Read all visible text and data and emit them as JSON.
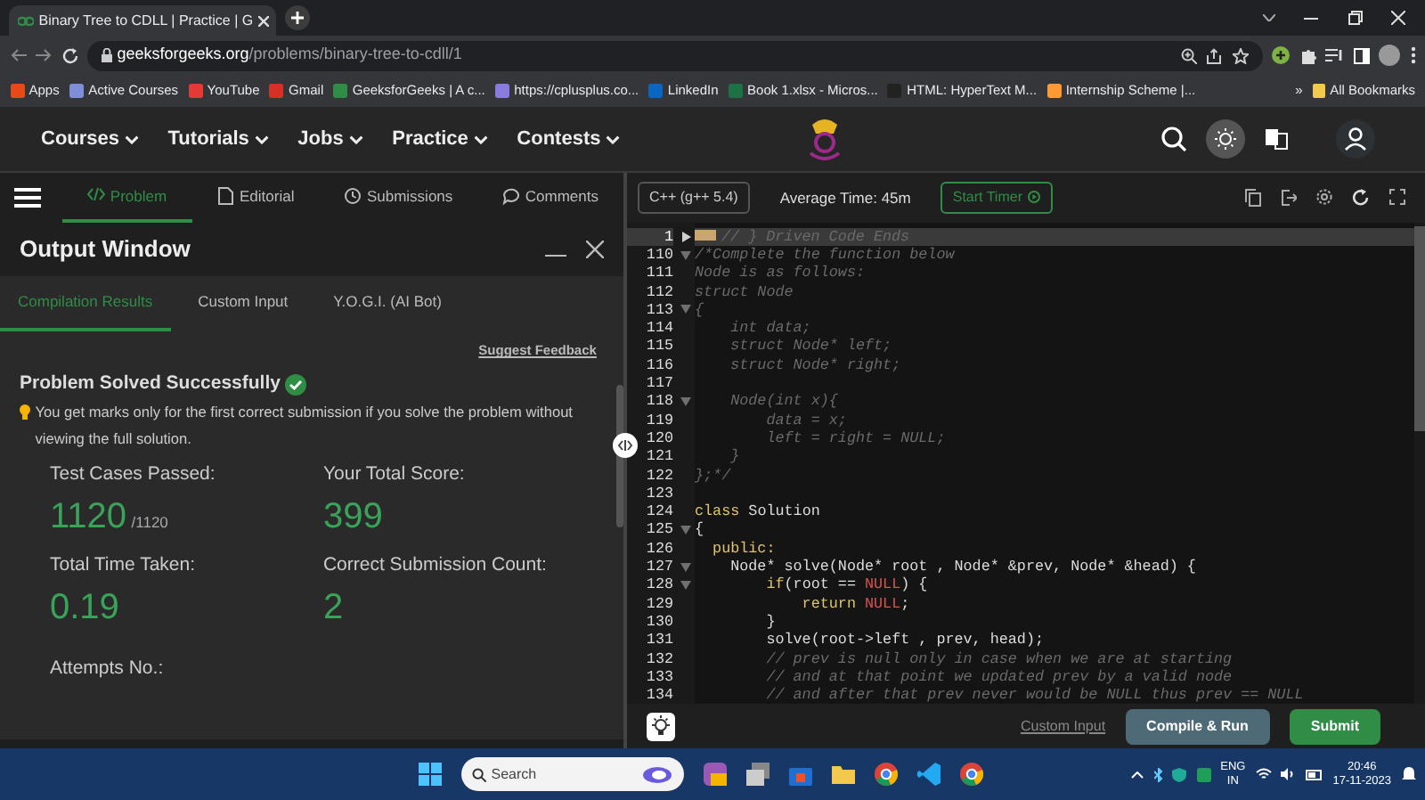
{
  "browser": {
    "tab": {
      "title": "Binary Tree to CDLL | Practice | G"
    },
    "address": {
      "domain": "geeksforgeeks.org",
      "path": "/problems/binary-tree-to-cdll/1"
    },
    "bookmarks": [
      {
        "label": "Apps"
      },
      {
        "label": "Active Courses"
      },
      {
        "label": "YouTube"
      },
      {
        "label": "Gmail"
      },
      {
        "label": "GeeksforGeeks | A c..."
      },
      {
        "label": "https://cplusplus.co..."
      },
      {
        "label": "LinkedIn"
      },
      {
        "label": "Book 1.xlsx - Micros..."
      },
      {
        "label": "HTML: HyperText M..."
      },
      {
        "label": "Internship Scheme |..."
      }
    ],
    "more": "»",
    "all_bookmarks": "All Bookmarks"
  },
  "site_nav": [
    {
      "label": "Courses"
    },
    {
      "label": "Tutorials"
    },
    {
      "label": "Jobs"
    },
    {
      "label": "Practice"
    },
    {
      "label": "Contests"
    }
  ],
  "problem_tabs": [
    {
      "label": "Problem",
      "selected": true
    },
    {
      "label": "Editorial",
      "selected": false
    },
    {
      "label": "Submissions",
      "selected": false
    },
    {
      "label": "Comments",
      "selected": false
    }
  ],
  "output_window": {
    "title": "Output Window",
    "tabs": [
      {
        "label": "Compilation Results",
        "selected": true
      },
      {
        "label": "Custom Input",
        "selected": false
      },
      {
        "label": "Y.O.G.I. (AI Bot)",
        "selected": false
      }
    ],
    "suggest_feedback": "Suggest Feedback",
    "status": "Problem Solved Successfully",
    "note": "You get marks only for the first correct submission if you solve the problem without viewing the full solution.",
    "stats": [
      {
        "label": "Test Cases Passed:",
        "value": "1120",
        "suffix": "/1120"
      },
      {
        "label": "Your Total Score:",
        "value": "399"
      },
      {
        "label": "Total Time Taken:",
        "value": "0.19"
      },
      {
        "label": "Correct Submission Count:",
        "value": "2"
      }
    ],
    "next_label": "Attempts No.:"
  },
  "editor": {
    "language": "C++ (g++ 5.4)",
    "average_time": "Average Time: 45m",
    "timer": "Start Timer",
    "lines": [
      {
        "num": "1",
        "foldable": true,
        "collapsed": true,
        "highlighted": true,
        "segments": [
          {
            "kind": "marker"
          },
          {
            "kind": "comment",
            "t": "// } Driven Code Ends"
          }
        ]
      },
      {
        "num": "110",
        "foldable": true,
        "collapsed": false,
        "highlighted": false,
        "segments": [
          {
            "kind": "comment",
            "t": "/*Complete the function below"
          }
        ]
      },
      {
        "num": "111",
        "foldable": false,
        "collapsed": false,
        "highlighted": false,
        "segments": [
          {
            "kind": "comment",
            "t": "Node is as follows:"
          }
        ]
      },
      {
        "num": "112",
        "foldable": false,
        "collapsed": false,
        "highlighted": false,
        "segments": [
          {
            "kind": "comment",
            "t": "struct Node"
          }
        ]
      },
      {
        "num": "113",
        "foldable": true,
        "collapsed": false,
        "highlighted": false,
        "segments": [
          {
            "kind": "comment",
            "t": "{"
          }
        ]
      },
      {
        "num": "114",
        "foldable": false,
        "collapsed": false,
        "highlighted": false,
        "segments": [
          {
            "kind": "comment",
            "t": "    int data;"
          }
        ]
      },
      {
        "num": "115",
        "foldable": false,
        "collapsed": false,
        "highlighted": false,
        "segments": [
          {
            "kind": "comment",
            "t": "    struct Node* left;"
          }
        ]
      },
      {
        "num": "116",
        "foldable": false,
        "collapsed": false,
        "highlighted": false,
        "segments": [
          {
            "kind": "comment",
            "t": "    struct Node* right;"
          }
        ]
      },
      {
        "num": "117",
        "foldable": false,
        "collapsed": false,
        "highlighted": false
      },
      {
        "num": "118",
        "foldable": true,
        "collapsed": false,
        "highlighted": false,
        "segments": [
          {
            "kind": "comment",
            "t": "    Node(int x){"
          }
        ]
      },
      {
        "num": "119",
        "foldable": false,
        "collapsed": false,
        "highlighted": false,
        "segments": [
          {
            "kind": "comment",
            "t": "        data = x;"
          }
        ]
      },
      {
        "num": "120",
        "foldable": false,
        "collapsed": false,
        "highlighted": false,
        "segments": [
          {
            "kind": "comment",
            "t": "        left = right = NULL;"
          }
        ]
      },
      {
        "num": "121",
        "foldable": false,
        "collapsed": false,
        "highlighted": false,
        "segments": [
          {
            "kind": "comment",
            "t": "    }"
          }
        ]
      },
      {
        "num": "122",
        "foldable": false,
        "collapsed": false,
        "highlighted": false,
        "segments": [
          {
            "kind": "comment",
            "t": "};*/"
          }
        ]
      },
      {
        "num": "123",
        "foldable": false,
        "collapsed": false,
        "highlighted": false
      },
      {
        "num": "124",
        "foldable": false,
        "collapsed": false,
        "highlighted": false,
        "segments": [
          {
            "kind": "keyword",
            "t": "class"
          },
          {
            "kind": "text",
            "t": " Solution"
          }
        ]
      },
      {
        "num": "125",
        "foldable": true,
        "collapsed": false,
        "highlighted": false,
        "segments": [
          {
            "kind": "text",
            "t": "{"
          }
        ]
      },
      {
        "num": "126",
        "foldable": false,
        "collapsed": false,
        "highlighted": false,
        "segments": [
          {
            "kind": "keyword",
            "t": "  public:"
          }
        ]
      },
      {
        "num": "127",
        "foldable": true,
        "collapsed": false,
        "highlighted": false,
        "segments": [
          {
            "kind": "text",
            "t": "    Node* solve(Node* root , Node* &prev, Node* &head) {"
          }
        ]
      },
      {
        "num": "128",
        "foldable": true,
        "collapsed": false,
        "highlighted": false,
        "segments": [
          {
            "kind": "keyword",
            "t": "        if"
          },
          {
            "kind": "text",
            "t": "(root == "
          },
          {
            "kind": "constant",
            "t": "NULL"
          },
          {
            "kind": "text",
            "t": ") {"
          }
        ]
      },
      {
        "num": "129",
        "foldable": false,
        "collapsed": false,
        "highlighted": false,
        "segments": [
          {
            "kind": "keyword",
            "t": "            return "
          },
          {
            "kind": "constant",
            "t": "NULL"
          },
          {
            "kind": "text",
            "t": ";"
          }
        ]
      },
      {
        "num": "130",
        "foldable": false,
        "collapsed": false,
        "highlighted": false,
        "segments": [
          {
            "kind": "text",
            "t": "        }"
          }
        ]
      },
      {
        "num": "131",
        "foldable": false,
        "collapsed": false,
        "highlighted": false,
        "segments": [
          {
            "kind": "text",
            "t": "        solve(root->left , prev, head);"
          }
        ]
      },
      {
        "num": "132",
        "foldable": false,
        "collapsed": false,
        "highlighted": false,
        "segments": [
          {
            "kind": "comment",
            "t": "        // prev is null only in case when we are at starting"
          }
        ]
      },
      {
        "num": "133",
        "foldable": false,
        "collapsed": false,
        "highlighted": false,
        "segments": [
          {
            "kind": "comment",
            "t": "        // and at that point we updated prev by a valid node"
          }
        ]
      },
      {
        "num": "134",
        "foldable": false,
        "collapsed": false,
        "highlighted": false,
        "segments": [
          {
            "kind": "comment",
            "t": "        // and after that prev never would be NULL thus prev == NULL"
          }
        ]
      }
    ],
    "custom_input": "Custom Input",
    "compile_button": "Compile & Run",
    "submit_button": "Submit"
  },
  "taskbar": {
    "search": "Search",
    "language": "ENG",
    "region": "IN",
    "time": "20:46",
    "date": "17-11-2023"
  }
}
